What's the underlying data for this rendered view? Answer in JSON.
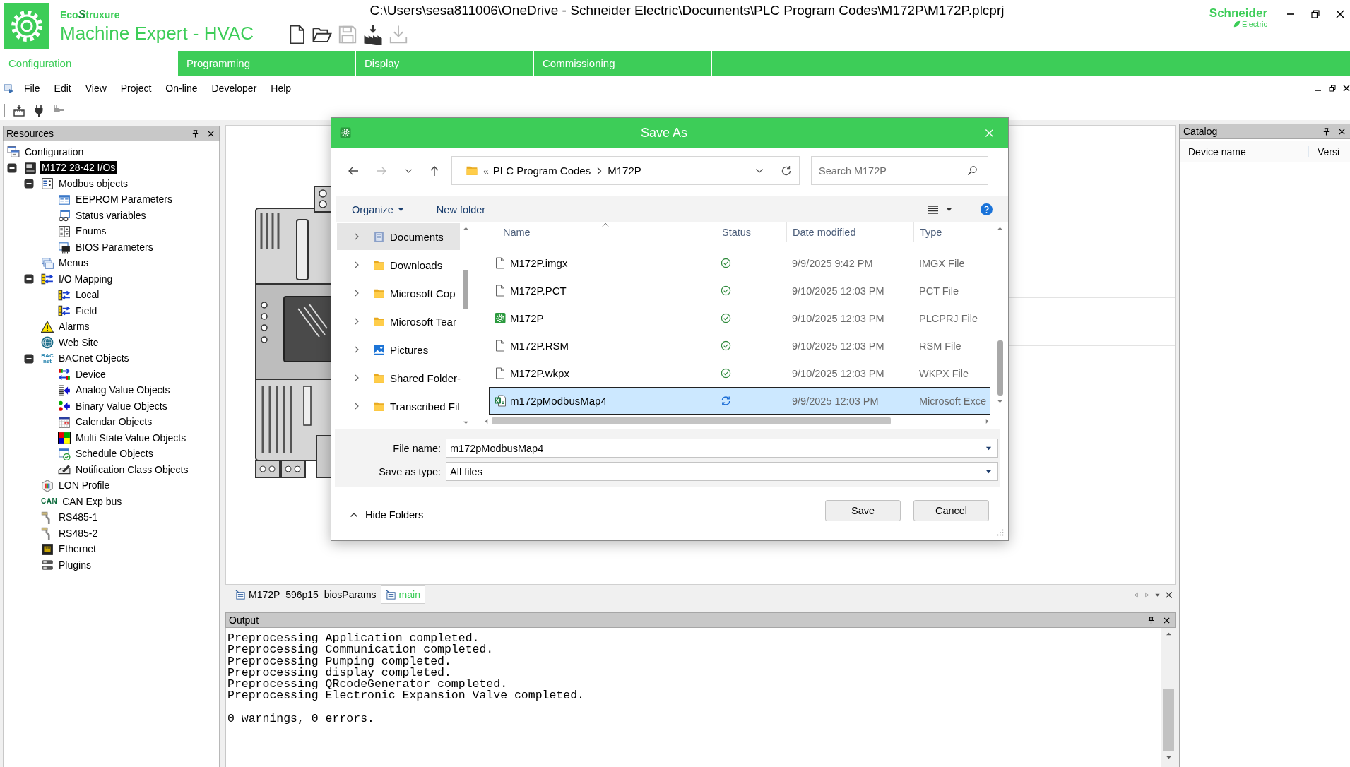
{
  "app": {
    "brand": "Eco**S**truxure",
    "product": "Machine Expert - HVAC"
  },
  "window": {
    "title": "C:\\Users\\sesa811006\\OneDrive - Schneider Electric\\Documents\\PLC Program Codes\\M172P\\M172P.plcprj"
  },
  "file_toolbar": [
    {
      "disabled": false
    },
    {
      "disabled": false
    },
    {
      "disabled": true
    },
    {
      "disabled": false
    },
    {
      "disabled": true
    }
  ],
  "vendor": {
    "name": "Schneider",
    "sub": "Electric"
  },
  "tabs": [
    {
      "label": "Configuration",
      "selected": true
    },
    {
      "label": "Programming",
      "selected": false
    },
    {
      "label": "Display",
      "selected": false
    },
    {
      "label": "Commissioning",
      "selected": false
    }
  ],
  "menu": [
    "File",
    "Edit",
    "View",
    "Project",
    "On-line",
    "Developer",
    "Help"
  ],
  "toolbar": [
    {
      "disabled": false
    },
    {
      "disabled": false
    },
    {
      "disabled": true
    }
  ],
  "resources": {
    "title": "Resources",
    "tree": [
      {
        "label": "Configuration",
        "selected": false,
        "children": [
          {
            "label": "M172 28-42 I/Os",
            "selected": true,
            "expanded": true,
            "children": [
              {
                "label": "Modbus objects",
                "selected": false,
                "expanded": true,
                "children": [
                  {
                    "label": "EEPROM Parameters",
                    "selected": false
                  },
                  {
                    "label": "Status variables",
                    "selected": false
                  },
                  {
                    "label": "Enums",
                    "selected": false
                  },
                  {
                    "label": "BIOS Parameters",
                    "selected": false
                  }
                ]
              },
              {
                "label": "Menus",
                "selected": false
              },
              {
                "label": "I/O Mapping",
                "selected": false,
                "expanded": true,
                "children": [
                  {
                    "label": "Local",
                    "selected": false
                  },
                  {
                    "label": "Field",
                    "selected": false
                  }
                ]
              },
              {
                "label": "Alarms",
                "selected": false
              },
              {
                "label": "Web Site",
                "selected": false
              },
              {
                "label": "BACnet Objects",
                "icon_text": [
                  "BAC",
                  "net"
                ],
                "selected": false,
                "expanded": true,
                "children": [
                  {
                    "label": "Device",
                    "selected": false
                  },
                  {
                    "label": "Analog Value Objects",
                    "selected": false
                  },
                  {
                    "label": "Binary Value Objects",
                    "selected": false
                  },
                  {
                    "label": "Calendar Objects",
                    "selected": false
                  },
                  {
                    "label": "Multi State Value Objects",
                    "selected": false
                  },
                  {
                    "label": "Schedule Objects",
                    "selected": false
                  },
                  {
                    "label": "Notification Class Objects",
                    "selected": false
                  }
                ]
              },
              {
                "label": "LON Profile",
                "selected": false
              },
              {
                "label": "CAN Exp bus",
                "icon_text": [
                  "CAN"
                ],
                "selected": false
              },
              {
                "label": "RS485-1",
                "selected": false
              },
              {
                "label": "RS485-2",
                "selected": false
              },
              {
                "label": "Ethernet",
                "selected": false
              },
              {
                "label": "Plugins",
                "selected": false
              }
            ]
          }
        ]
      }
    ]
  },
  "editor": {
    "doc_tabs": [
      {
        "label": "M172P_596p15_biosParams",
        "selected": false
      },
      {
        "label": "main",
        "selected": true
      }
    ]
  },
  "dialog": {
    "title": "Save As",
    "nav_buttons": [
      {
        "disabled": false
      },
      {
        "disabled": true
      },
      {
        "disabled": false
      },
      {
        "disabled": false
      }
    ],
    "address": {
      "overflow": "«",
      "path": [
        "PLC Program Codes",
        "M172P"
      ]
    },
    "search": {
      "placeholder": "Search M172P"
    },
    "commands": [
      {
        "label": "Organize",
        "menu": true
      },
      {
        "label": "New folder",
        "menu": false
      }
    ],
    "folders": [
      {
        "label": "Documents",
        "selected": true,
        "expanded": false
      },
      {
        "label": "Downloads",
        "selected": false,
        "expanded": false
      },
      {
        "label": "Microsoft Cop",
        "selected": false,
        "expanded": false
      },
      {
        "label": "Microsoft Tear",
        "selected": false,
        "expanded": false
      },
      {
        "label": "Pictures",
        "selected": false,
        "expanded": false
      },
      {
        "label": "Shared Folder-",
        "selected": false,
        "expanded": false
      },
      {
        "label": "Transcribed Fil",
        "selected": false,
        "expanded": false
      }
    ],
    "columns": [
      {
        "label": "Name",
        "sorted": true
      },
      {
        "label": "Status",
        "sorted": false
      },
      {
        "label": "Date modified",
        "sorted": false
      },
      {
        "label": "Type",
        "sorted": false
      }
    ],
    "files": [
      {
        "name": "M172P.imgx",
        "synced": true,
        "date": "9/9/2025 9:42 PM",
        "type": "IMGX File",
        "selected": false
      },
      {
        "name": "M172P.PCT",
        "synced": true,
        "date": "9/10/2025 12:03 PM",
        "type": "PCT File",
        "selected": false
      },
      {
        "name": "M172P",
        "synced": true,
        "date": "9/10/2025 12:03 PM",
        "type": "PLCPRJ File",
        "selected": false
      },
      {
        "name": "M172P.RSM",
        "synced": true,
        "date": "9/10/2025 12:03 PM",
        "type": "RSM File",
        "selected": false
      },
      {
        "name": "M172P.wkpx",
        "synced": true,
        "date": "9/10/2025 12:03 PM",
        "type": "WKPX File",
        "selected": false
      },
      {
        "name": "m172pModbusMap4",
        "synced": false,
        "date": "9/9/2025 12:03 PM",
        "type": "Microsoft Exce",
        "selected": true
      }
    ],
    "file_name": {
      "label": "File name:",
      "value": "m172pModbusMap4"
    },
    "save_type": {
      "label": "Save as type:",
      "value": "All files"
    },
    "hide_folders": "Hide Folders",
    "buttons": [
      "Save",
      "Cancel"
    ]
  },
  "output": {
    "title": "Output",
    "paragraphs": [
      [
        "Preprocessing Application completed.",
        "Preprocessing Communication completed.",
        "Preprocessing Pumping completed.",
        "Preprocessing display completed.",
        "Preprocessing QRcodeGenerator completed.",
        "Preprocessing Electronic Expansion Valve completed."
      ],
      [
        "0 warnings, 0 errors."
      ]
    ]
  },
  "catalog": {
    "title": "Catalog",
    "columns": [
      "Device name",
      "Versi"
    ]
  }
}
